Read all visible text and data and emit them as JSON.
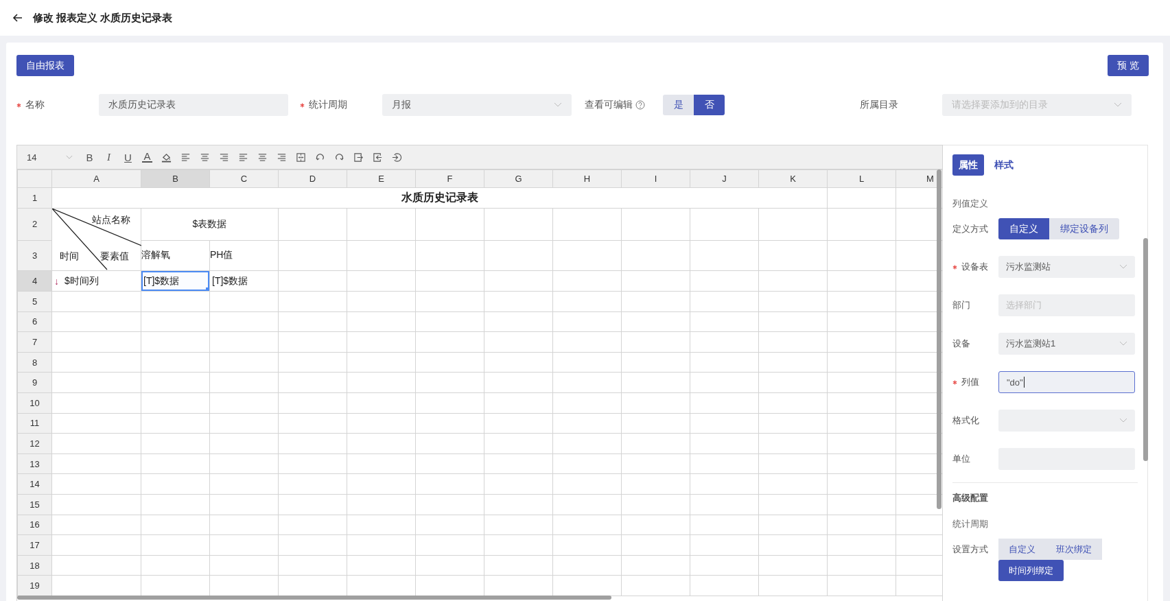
{
  "header": {
    "title": "修改 报表定义 水质历史记录表"
  },
  "mode_button": "自由报表",
  "preview_button": "预 览",
  "form": {
    "name": {
      "label": "名称",
      "required": true,
      "value": "水质历史记录表"
    },
    "period": {
      "label": "统计周期",
      "required": true,
      "value": "月报"
    },
    "editable": {
      "label": "查看可编辑",
      "options": [
        {
          "label": "是",
          "selected": false
        },
        {
          "label": "否",
          "selected": true
        }
      ]
    },
    "catalog": {
      "label": "所属目录",
      "required": false,
      "placeholder": "请选择要添加到的目录"
    }
  },
  "sheet": {
    "toolbar": {
      "font_size": "14",
      "items": [
        {
          "kind": "bold",
          "label": "B"
        },
        {
          "kind": "italic",
          "label": "I"
        },
        {
          "kind": "underline",
          "label": "U"
        },
        {
          "kind": "font-color",
          "label": "A"
        },
        {
          "kind": "fill"
        },
        {
          "kind": "align-left"
        },
        {
          "kind": "align-center"
        },
        {
          "kind": "align-right"
        },
        {
          "kind": "align-left"
        },
        {
          "kind": "align-center"
        },
        {
          "kind": "align-right"
        },
        {
          "kind": "merge"
        },
        {
          "kind": "rotate-left"
        },
        {
          "kind": "rotate-right"
        },
        {
          "kind": "box-arrow-right"
        },
        {
          "kind": "box-arrow-left"
        },
        {
          "kind": "circle-arrow"
        }
      ]
    },
    "columns": [
      {
        "label": "A",
        "selected": false
      },
      {
        "label": "B",
        "selected": true
      },
      {
        "label": "C",
        "selected": false
      },
      {
        "label": "D",
        "selected": false
      },
      {
        "label": "E",
        "selected": false
      },
      {
        "label": "F",
        "selected": false
      },
      {
        "label": "G",
        "selected": false
      },
      {
        "label": "H",
        "selected": false
      },
      {
        "label": "I",
        "selected": false
      },
      {
        "label": "J",
        "selected": false
      },
      {
        "label": "K",
        "selected": false
      },
      {
        "label": "L",
        "selected": false
      },
      {
        "label": "M",
        "selected": false
      }
    ],
    "rows": [
      {
        "label": "1",
        "selected": false
      },
      {
        "label": "2",
        "selected": false
      },
      {
        "label": "3",
        "selected": false
      },
      {
        "label": "4",
        "selected": true
      },
      {
        "label": "5",
        "selected": false
      },
      {
        "label": "6",
        "selected": false
      },
      {
        "label": "7",
        "selected": false
      },
      {
        "label": "8",
        "selected": false
      },
      {
        "label": "9",
        "selected": false
      },
      {
        "label": "10",
        "selected": false
      },
      {
        "label": "11",
        "selected": false
      },
      {
        "label": "12",
        "selected": false
      },
      {
        "label": "13",
        "selected": false
      },
      {
        "label": "14",
        "selected": false
      },
      {
        "label": "15",
        "selected": false
      },
      {
        "label": "16",
        "selected": false
      },
      {
        "label": "17",
        "selected": false
      },
      {
        "label": "18",
        "selected": false
      },
      {
        "label": "19",
        "selected": false
      }
    ],
    "title": "水质历史记录表",
    "corner": {
      "top": "站点名称",
      "left": "时间",
      "right": "要素值"
    },
    "group_header": "$表数据",
    "sub_headers": [
      "溶解氧",
      "PH值"
    ],
    "data_cells": [
      {
        "marker": "↓",
        "text": "$时间列",
        "selected": false
      },
      {
        "text": "[T]$数据",
        "selected": true
      },
      {
        "text": "[T]$数据",
        "selected": false
      }
    ]
  },
  "panel": {
    "tabs": [
      {
        "label": "属性",
        "selected": true
      },
      {
        "label": "样式",
        "selected": false
      }
    ],
    "section": "列值定义",
    "fields": [
      {
        "kind": "segmented",
        "label": "定义方式",
        "required": false,
        "options": [
          {
            "label": "自定义",
            "selected": true
          },
          {
            "label": "绑定设备列",
            "selected": false
          }
        ]
      },
      {
        "kind": "select",
        "label": "设备表",
        "required": true,
        "value": "污水监测站"
      },
      {
        "kind": "input",
        "label": "部门",
        "required": false,
        "placeholder": "选择部门"
      },
      {
        "kind": "select",
        "label": "设备",
        "required": false,
        "value": "污水监测站1"
      },
      {
        "kind": "input",
        "label": "列值",
        "required": true,
        "value": "\"do\"",
        "focused": true
      },
      {
        "kind": "select",
        "label": "格式化",
        "required": false
      },
      {
        "kind": "input",
        "label": "单位",
        "required": false
      }
    ],
    "advanced": {
      "title": "高级配置",
      "subtitle": "统计周期",
      "mode": {
        "label": "设置方式",
        "options": [
          {
            "label": "自定义",
            "selected": false
          },
          {
            "label": "班次绑定",
            "selected": false
          },
          {
            "label": "时间列绑定",
            "selected": true
          }
        ]
      }
    }
  }
}
